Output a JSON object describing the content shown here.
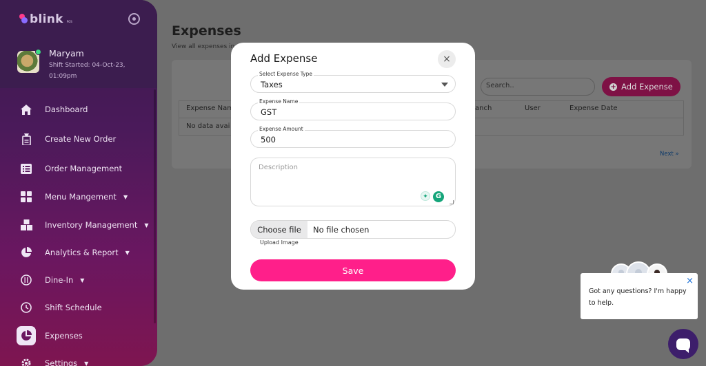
{
  "app": {
    "logo_text": "blink",
    "logo_sub": "POS"
  },
  "user": {
    "name": "Maryam",
    "shift": "Shift Started: 04-Oct-23, 01:09pm"
  },
  "sidebar": {
    "items": [
      {
        "label": "Dashboard",
        "icon": "home-icon"
      },
      {
        "label": "Create New Order",
        "icon": "receipt-icon"
      },
      {
        "label": "Order Management",
        "icon": "list-icon"
      },
      {
        "label": "Menu Mangement",
        "icon": "grid-icon"
      },
      {
        "label": "Inventory Management",
        "icon": "boxes-icon"
      },
      {
        "label": "Analytics & Report",
        "icon": "pie-chart-icon"
      },
      {
        "label": "Dine-In",
        "icon": "dine-icon"
      },
      {
        "label": "Shift Schedule",
        "icon": "clock-icon"
      },
      {
        "label": "Expenses",
        "icon": "expenses-icon"
      },
      {
        "label": "Settings",
        "icon": "gear-icon"
      }
    ]
  },
  "page": {
    "title": "Expenses",
    "subtitle": "View all expenses in",
    "search_placeholder": "Search..",
    "add_button": "Add Expense",
    "columns": [
      "Expense Nam",
      "anch",
      "User",
      "Expense Date"
    ],
    "empty_text": "No data avai",
    "next_label": "Next »"
  },
  "modal": {
    "title": "Add Expense",
    "close": "×",
    "type_label": "Select Expense Type",
    "type_value": "Taxes",
    "name_label": "Expense Name",
    "name_value": "GST",
    "amount_label": "Expense Amount",
    "amount_value": "500",
    "description_placeholder": "Description",
    "file_button": "Choose file",
    "file_status": "No file chosen",
    "upload_label": "Upload Image",
    "save_label": "Save"
  },
  "chat": {
    "message": "Got any questions? I'm happy to help.",
    "close": "×"
  }
}
